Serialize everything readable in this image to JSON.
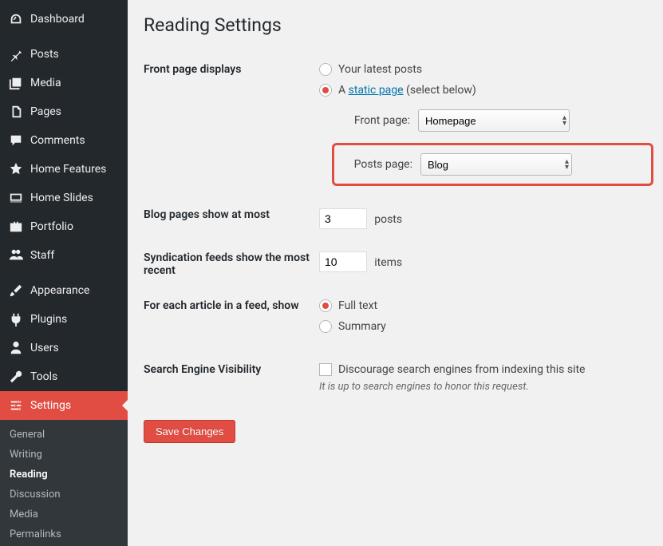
{
  "sidebar": {
    "items": [
      {
        "label": "Dashboard",
        "icon": "dashboard"
      },
      {
        "label": "Posts",
        "icon": "pin"
      },
      {
        "label": "Media",
        "icon": "media"
      },
      {
        "label": "Pages",
        "icon": "pages"
      },
      {
        "label": "Comments",
        "icon": "comment"
      },
      {
        "label": "Home Features",
        "icon": "star"
      },
      {
        "label": "Home Slides",
        "icon": "slides"
      },
      {
        "label": "Portfolio",
        "icon": "portfolio"
      },
      {
        "label": "Staff",
        "icon": "users"
      },
      {
        "label": "Appearance",
        "icon": "brush"
      },
      {
        "label": "Plugins",
        "icon": "plug"
      },
      {
        "label": "Users",
        "icon": "user"
      },
      {
        "label": "Tools",
        "icon": "wrench"
      },
      {
        "label": "Settings",
        "icon": "sliders",
        "active": true
      }
    ],
    "submenu": [
      {
        "label": "General"
      },
      {
        "label": "Writing"
      },
      {
        "label": "Reading",
        "current": true
      },
      {
        "label": "Discussion"
      },
      {
        "label": "Media"
      },
      {
        "label": "Permalinks"
      }
    ]
  },
  "page": {
    "title": "Reading Settings",
    "save_label": "Save Changes"
  },
  "settings": {
    "front_page": {
      "label": "Front page displays",
      "opt_latest": "Your latest posts",
      "opt_static_prefix": "A ",
      "opt_static_link": "static page",
      "opt_static_suffix": " (select below)",
      "front_page_label": "Front page:",
      "front_page_value": "Homepage",
      "posts_page_label": "Posts page:",
      "posts_page_value": "Blog"
    },
    "blog_pages": {
      "label": "Blog pages show at most",
      "value": "3",
      "unit": "posts"
    },
    "syndication": {
      "label": "Syndication feeds show the most recent",
      "value": "10",
      "unit": "items"
    },
    "feed_content": {
      "label": "For each article in a feed, show",
      "opt_full": "Full text",
      "opt_summary": "Summary"
    },
    "search_vis": {
      "label": "Search Engine Visibility",
      "check_label": "Discourage search engines from indexing this site",
      "desc": "It is up to search engines to honor this request."
    }
  }
}
